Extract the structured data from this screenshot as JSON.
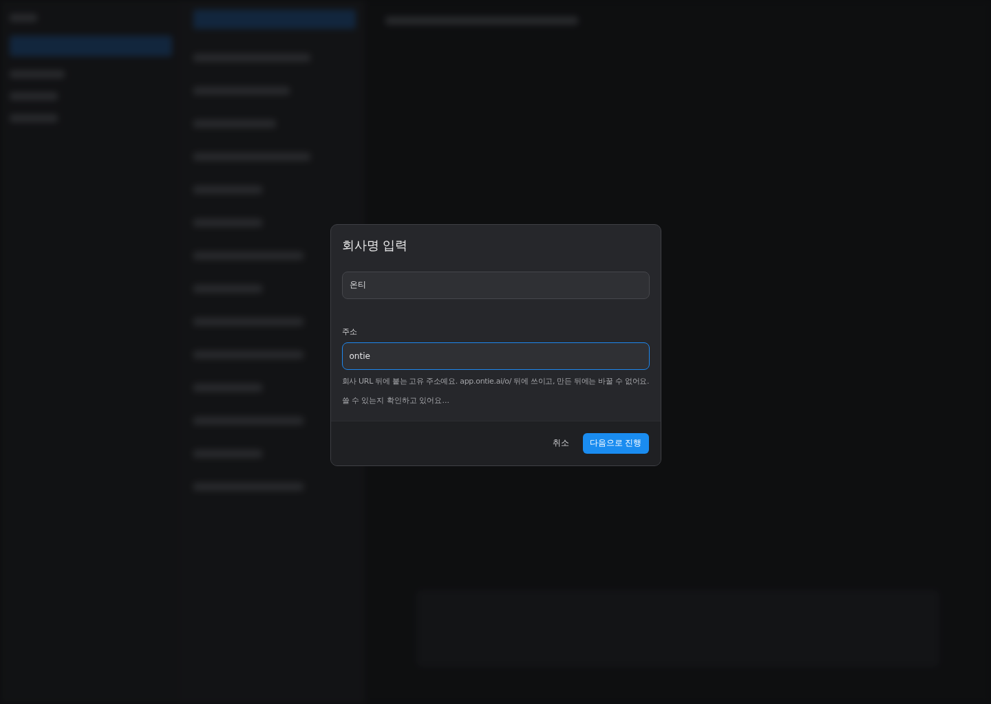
{
  "dialog": {
    "title": "회사명 입력",
    "name_field": {
      "value": "온티"
    },
    "address_field": {
      "label": "주소",
      "value": "ontie",
      "focused": true
    },
    "hint": "회사 URL 뒤에 붙는 고유 주소예요. app.ontie.ai/o/ 뒤에 쓰이고, 만든 뒤에는 바꿀 수 없어요.",
    "status": "쓸 수 있는지 확인하고 있어요...",
    "buttons": [
      {
        "label": "취소",
        "kind": "secondary"
      },
      {
        "label": "다음으로 진행",
        "kind": "primary"
      }
    ]
  }
}
